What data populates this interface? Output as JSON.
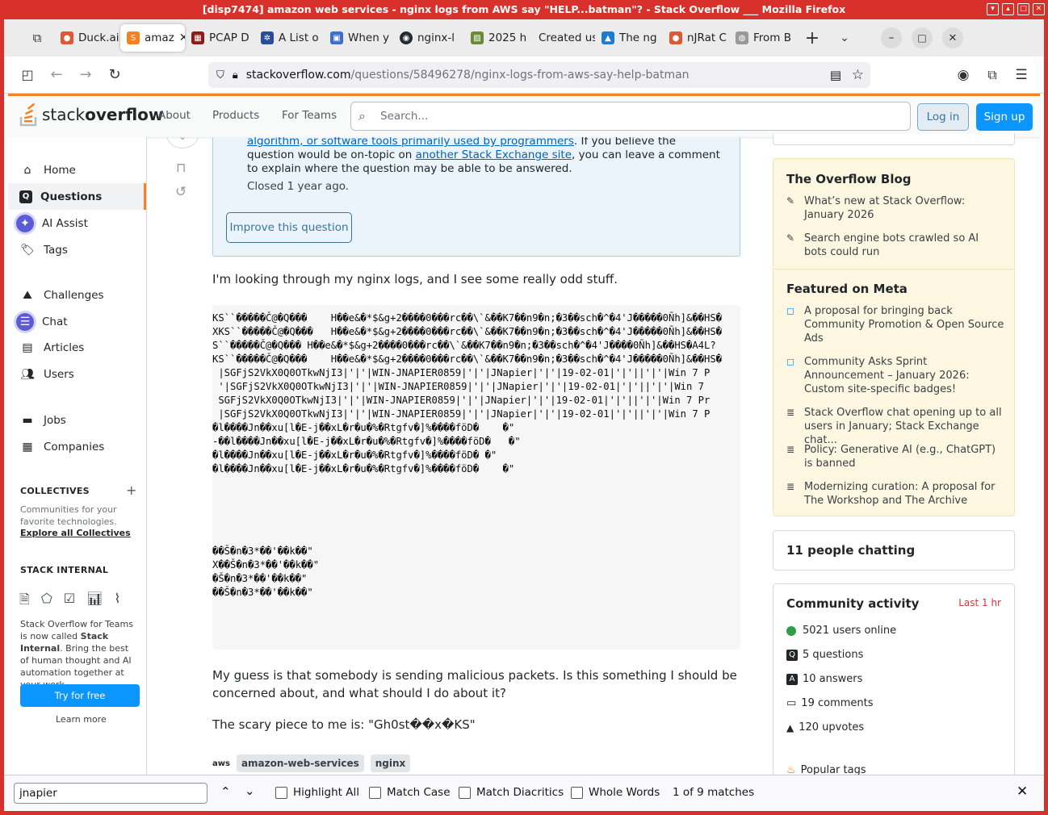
{
  "window": {
    "title": "[disp7474] amazon web services - nginx logs from AWS say \"HELP...batman\"? - Stack Overflow ___ Mozilla Firefox"
  },
  "tabs": [
    {
      "label": "Duck.ai",
      "color": "#de5833"
    },
    {
      "label": "amaz",
      "color": "#f48225"
    },
    {
      "label": "PCAP D",
      "color": "#8b1a1a"
    },
    {
      "label": "A List o",
      "color": "#2a4d9b"
    },
    {
      "label": "When y",
      "color": "#3b6ecf"
    },
    {
      "label": "nginх-l",
      "color": "#24292f"
    },
    {
      "label": "2025 h",
      "color": "#6a8a3a"
    },
    {
      "label": "Created us",
      "color": "#cccccc"
    },
    {
      "label": "The ng",
      "color": "#1f7ad1"
    },
    {
      "label": "nJRat C",
      "color": "#de5833"
    },
    {
      "label": "From B",
      "color": "#999999"
    }
  ],
  "url": {
    "domain": "stackoverflow.com",
    "path": "/questions/58496278/nginx-logs-from-aws-say-help-batman"
  },
  "header": {
    "logo_a": "stack",
    "logo_b": "overflow",
    "about": "About",
    "products": "Products",
    "for_teams": "For Teams",
    "search_placeholder": "Search...",
    "login": "Log in",
    "signup": "Sign up"
  },
  "leftnav": {
    "home": "Home",
    "questions": "Questions",
    "ai_assist": "AI Assist",
    "tags": "Tags",
    "challenges": "Challenges",
    "chat": "Chat",
    "articles": "Articles",
    "users": "Users",
    "jobs": "Jobs",
    "companies": "Companies",
    "collectives_h": "COLLECTIVES",
    "collectives_text": "Communities for your favorite technologies.",
    "collectives_link": "Explore all Collectives",
    "internal_h": "STACK INTERNAL",
    "internal_text_a": "Stack Overflow for Teams is now called ",
    "internal_bold": "Stack Internal",
    "internal_text_b": ". Bring the best of human thought and AI automation together at your work.",
    "try_free": "Try for free",
    "learn_more": "Learn more"
  },
  "closed_notice": {
    "link1": "algorithm, or software tools primarily used by programmers",
    "text1": ". If you believe the question would be on-topic on ",
    "link2": "another Stack Exchange site",
    "text2": ", you can leave a comment to explain where the question may be able to be answered.",
    "closed": "Closed 1 year ago.",
    "improve": "Improve this question"
  },
  "question": {
    "p1": "I'm looking through my nginx logs, and I see some really odd stuff.",
    "code_lines": [
      "KS``�����Č@�Q���    H��e&�*$&g+2����0���rc��\\`&��K7��n9�n;�3��sch�^�4'J�����0Ñh]&��HS�",
      "XKS``�����Č@�Q���   H��e&�*$&g+2����0���rc��\\`&��K7��n9�n;�3��sch�^�4'J�����0Ñh]&��HS�",
      "S``�����Č@�Q��� H��e&�*$&g+2����0���rc��\\`&��K7��n9�n;�3��sch�^�4'J����0Ñh]&��HS�A4L?",
      "KS``�����Č@�Q���    H��e&�*$&g+2����0���rc��\\`&��K7��n9�n;�3��sch�^�4'J�����0Ñh]&��HS�",
      " |SGFjS2VkX0Q0OTkwNjI3|'|'|WIN-JNAPIER0859|'|'|JNapier|'|'|19-02-01|'|'||'|'|Win 7 P",
      " '|SGFjS2VkX0Q0OTkwNjI3|'|'|WIN-JNAPIER0859|'|'|JNapier|'|'|19-02-01|'|'||'|'|Win 7",
      " SGFjS2VkX0Q0OTkwNjI3|'|'|WIN-JNAPIER0859|'|'|JNapier|'|'|19-02-01|'|'||'|'|Win 7 Pr",
      " |SGFjS2VkX0Q0OTkwNjI3|'|'|WIN-JNAPIER0859|'|'|JNapier|'|'|19-02-01|'|'||'|'|Win 7 P",
      "�l����Jn��xu[l�E-j��xL�r�u�%�Rtgfv�]%����föD�    �\"",
      "-��l����Jn��xu[l�E-j��xL�r�u�%�Rtgfv�]%����föD�   �\"",
      "�l����Jn��xu[l�E-j��xL�r�u�%�Rtgfv�]%����föD� �\"",
      "�l����Jn��xu[l�E-j��xL�r�u�%�Rtgfv�]%����föD�    �\"",
      "",
      "",
      "",
      "",
      "",
      "��Š�n�3*��'��k��\"",
      "X��Š�n�3*��'��k��\"",
      "�Š�n�3*��'��k��\"",
      "��Š�n�3*��'��k��\""
    ],
    "p2": "My guess is that somebody is sending malicious packets. Is this something I should be concerned about, and what should I do about it?",
    "p3": "The scary piece to me is: \"Gh0st��x�KS\"",
    "tags": [
      "amazon-web-services",
      "nginx"
    ]
  },
  "blog": {
    "title": "The Overflow Blog",
    "items": [
      "What’s new at Stack Overflow: January 2026",
      "Search engine bots crawled so AI bots could run"
    ],
    "meta_title": "Featured on Meta",
    "meta_items": [
      "A proposal for bringing back Community Promotion & Open Source Ads",
      "Community Asks Sprint Announcement – January 2026: Custom site-specific badges!",
      "Stack Overflow chat opening up to all users in January; Stack Exchange chat...",
      "Policy: Generative AI (e.g., ChatGPT) is banned",
      "Modernizing curation: A proposal for The Workshop and The Archive"
    ]
  },
  "chat_box": {
    "title": "11 people chatting"
  },
  "community": {
    "title": "Community activity",
    "period": "Last 1 hr",
    "items": [
      "5021 users online",
      "5 questions",
      "10 answers",
      "19 comments",
      "120 upvotes"
    ],
    "popular": "Popular tags"
  },
  "findbar": {
    "value": "jnapier",
    "highlight": "Highlight All",
    "match_case": "Match Case",
    "diacritics": "Match Diacritics",
    "whole": "Whole Words",
    "count": "1 of 9 matches"
  }
}
